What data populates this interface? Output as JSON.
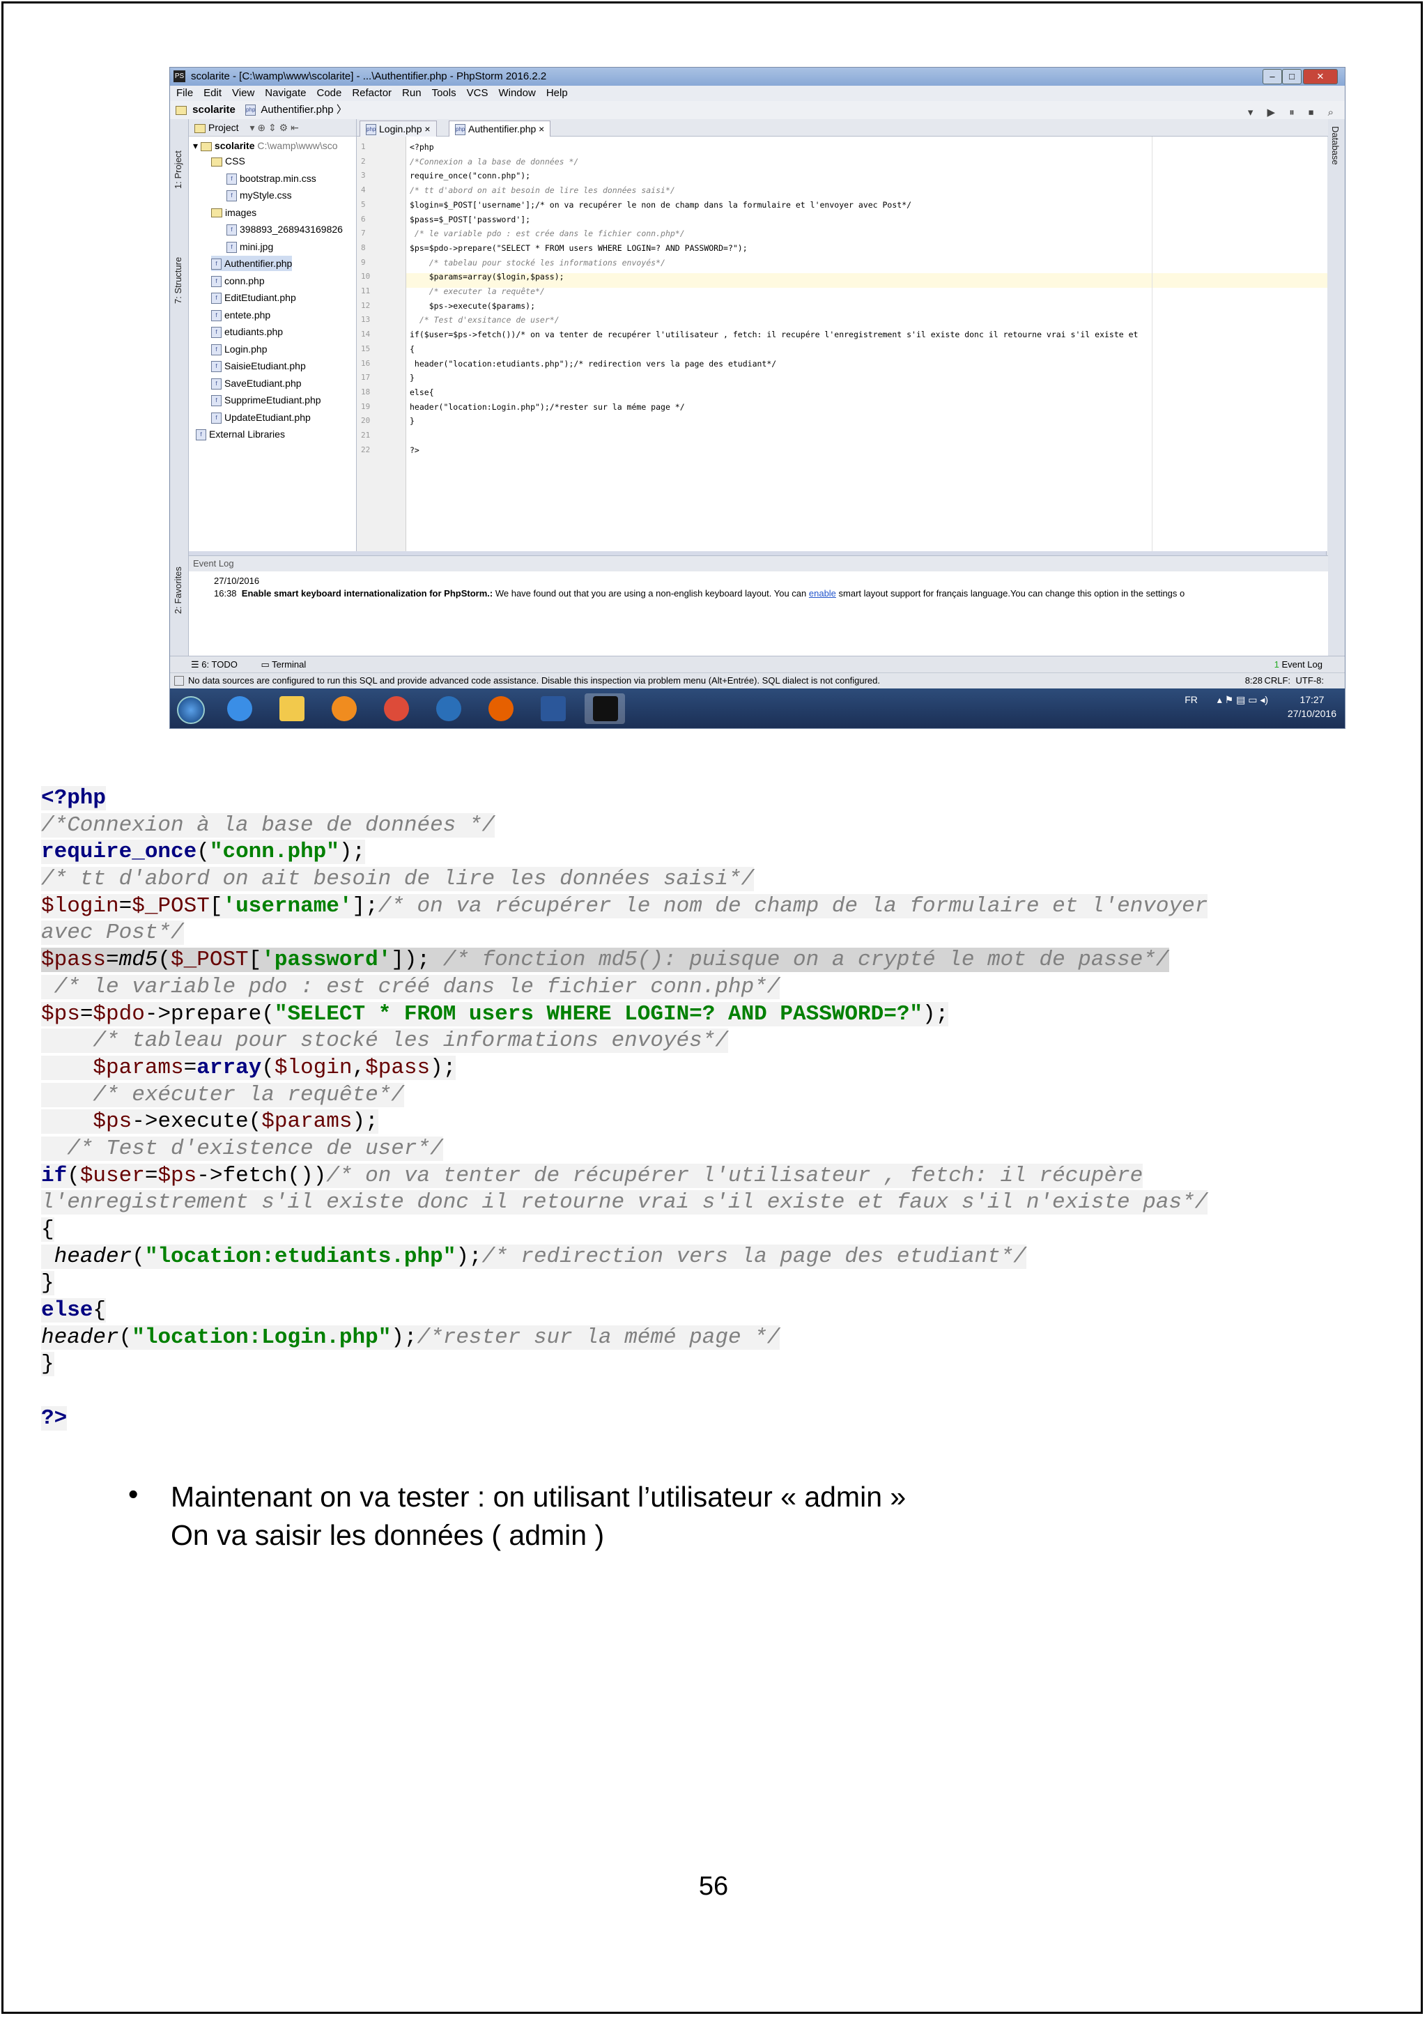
{
  "ide": {
    "window_title": "scolarite - [C:\\wamp\\www\\scolarite] - ...\\Authentifier.php - PhpStorm 2016.2.2",
    "menu": [
      "File",
      "Edit",
      "View",
      "Navigate",
      "Code",
      "Refactor",
      "Run",
      "Tools",
      "VCS",
      "Window",
      "Help"
    ],
    "breadcrumb": [
      "scolarite",
      "Authentifier.php"
    ],
    "left_strip": [
      "1: Project",
      "7: Structure",
      "2: Favorites"
    ],
    "right_strip": [
      "Database"
    ],
    "project_panel": {
      "title": "Project",
      "root": "scolarite",
      "root_path": "C:\\wamp\\www\\sco",
      "items": [
        {
          "label": "CSS",
          "type": "folder"
        },
        {
          "label": "bootstrap.min.css",
          "type": "file"
        },
        {
          "label": "myStyle.css",
          "type": "file"
        },
        {
          "label": "images",
          "type": "folder"
        },
        {
          "label": "398893_268943169826",
          "type": "file"
        },
        {
          "label": "mini.jpg",
          "type": "file"
        },
        {
          "label": "Authentifier.php",
          "type": "file"
        },
        {
          "label": "conn.php",
          "type": "file"
        },
        {
          "label": "EditEtudiant.php",
          "type": "file"
        },
        {
          "label": "entete.php",
          "type": "file"
        },
        {
          "label": "etudiants.php",
          "type": "file"
        },
        {
          "label": "Login.php",
          "type": "file"
        },
        {
          "label": "SaisieEtudiant.php",
          "type": "file"
        },
        {
          "label": "SaveEtudiant.php",
          "type": "file"
        },
        {
          "label": "SupprimeEtudiant.php",
          "type": "file"
        },
        {
          "label": "UpdateEtudiant.php",
          "type": "file"
        },
        {
          "label": "External Libraries",
          "type": "lib"
        }
      ]
    },
    "tabs": [
      "Login.php",
      "Authentifier.php"
    ],
    "editor_lines": [
      "<?php",
      "/*Connexion a la base de données */",
      "require_once(\"conn.php\");",
      "/* tt d'abord on ait besoin de lire les données saisi*/",
      "$login=$_POST['username'];/* on va recupérer le non de champ dans la formulaire et l'envoyer avec Post*/",
      "$pass=$_POST['password'];",
      " /* le variable pdo : est crée dans le fichier conn.php*/",
      "$ps=$pdo->prepare(\"SELECT * FROM users WHERE LOGIN=? AND PASSWORD=?\");",
      "    /* tabelau pour stocké les informations envoyés*/",
      "    $params=array($login,$pass);",
      "    /* executer la requête*/",
      "    $ps->execute($params);",
      "  /* Test d'exsitance de user*/",
      "if($user=$ps->fetch())/* on va tenter de recupérer l'utilisateur , fetch: il recupére l'enregistrement s'il existe donc il retourne vrai s'il existe et",
      "{",
      " header(\"location:etudiants.php\");/* redirection vers la page des etudiant*/",
      "}",
      "else{",
      "header(\"location:Login.php\");/*rester sur la méme page */",
      "}",
      "",
      "?>"
    ],
    "event_log": {
      "title": "Event Log",
      "date": "27/10/2016",
      "time": "16:38",
      "bold": "Enable smart keyboard internationalization for PhpStorm.:",
      "message": " We have found out that you are using a non-english keyboard layout. You can ",
      "link": "enable",
      "message_end": " smart layout support for français language.You can change this option in the settings o"
    },
    "bottom_tools": {
      "todo": "6: TODO",
      "terminal": "Terminal",
      "event_log": "Event Log",
      "event_count": "1"
    },
    "status": {
      "message": "No data sources are configured to run this SQL and provide advanced code assistance. Disable this inspection via problem menu (Alt+Entrée). SQL dialect is not configured.",
      "position": "8:28",
      "line_sep": "CRLF:",
      "encoding": "UTF-8:"
    },
    "taskbar": {
      "lang": "FR",
      "time": "17:27",
      "date": "27/10/2016"
    }
  },
  "code_listing": [
    [
      {
        "t": "<?php",
        "c": "kw"
      }
    ],
    [
      {
        "t": "/*Connexion à la base de données */",
        "c": "cm"
      }
    ],
    [
      {
        "t": "require_once",
        "c": "kw"
      },
      {
        "t": "(",
        "c": ""
      },
      {
        "t": "\"conn.php\"",
        "c": "str"
      },
      {
        "t": ");",
        "c": ""
      }
    ],
    [
      {
        "t": "/* tt d'abord on ait besoin de lire les données saisi*/",
        "c": "cm"
      }
    ],
    [
      {
        "t": "$login",
        "c": "var"
      },
      {
        "t": "=",
        "c": ""
      },
      {
        "t": "$_POST",
        "c": "var"
      },
      {
        "t": "[",
        "c": ""
      },
      {
        "t": "'username'",
        "c": "str"
      },
      {
        "t": "];",
        "c": ""
      },
      {
        "t": "/* on va récupérer le nom de champ de la formulaire et l'envoyer",
        "c": "cm"
      }
    ],
    [
      {
        "t": "avec Post*/",
        "c": "cm"
      }
    ],
    [
      {
        "t": "$pass",
        "c": "var"
      },
      {
        "t": "=",
        "c": ""
      },
      {
        "t": "md5",
        "c": "fn"
      },
      {
        "t": "(",
        "c": ""
      },
      {
        "t": "$_POST",
        "c": "var"
      },
      {
        "t": "[",
        "c": ""
      },
      {
        "t": "'password'",
        "c": "str"
      },
      {
        "t": "]); ",
        "c": ""
      },
      {
        "t": "/* fonction md5(): puisque on a crypté le mot de passe*/",
        "c": "cm"
      }
    ],
    [
      {
        "t": " /* le variable pdo : est créé dans le fichier conn.php*/",
        "c": "cm"
      }
    ],
    [
      {
        "t": "$ps",
        "c": "var"
      },
      {
        "t": "=",
        "c": ""
      },
      {
        "t": "$pdo",
        "c": "var"
      },
      {
        "t": "->prepare(",
        "c": ""
      },
      {
        "t": "\"SELECT * FROM users WHERE LOGIN=? AND PASSWORD=?\"",
        "c": "str"
      },
      {
        "t": ");",
        "c": ""
      }
    ],
    [
      {
        "t": "    /* tableau pour stocké les informations envoyés*/",
        "c": "cm"
      }
    ],
    [
      {
        "t": "    ",
        "c": ""
      },
      {
        "t": "$params",
        "c": "var"
      },
      {
        "t": "=",
        "c": ""
      },
      {
        "t": "array",
        "c": "kw"
      },
      {
        "t": "(",
        "c": ""
      },
      {
        "t": "$login",
        "c": "var"
      },
      {
        "t": ",",
        "c": ""
      },
      {
        "t": "$pass",
        "c": "var"
      },
      {
        "t": ");",
        "c": ""
      }
    ],
    [
      {
        "t": "    /* exécuter la requête*/",
        "c": "cm"
      }
    ],
    [
      {
        "t": "    ",
        "c": ""
      },
      {
        "t": "$ps",
        "c": "var"
      },
      {
        "t": "->execute(",
        "c": ""
      },
      {
        "t": "$params",
        "c": "var"
      },
      {
        "t": ");",
        "c": ""
      }
    ],
    [
      {
        "t": "  /* Test d'existence de user*/",
        "c": "cm"
      }
    ],
    [
      {
        "t": "if",
        "c": "kw"
      },
      {
        "t": "(",
        "c": ""
      },
      {
        "t": "$user",
        "c": "var"
      },
      {
        "t": "=",
        "c": ""
      },
      {
        "t": "$ps",
        "c": "var"
      },
      {
        "t": "->fetch())",
        "c": ""
      },
      {
        "t": "/* on va tenter de récupérer l'utilisateur , fetch: il récupère",
        "c": "cm"
      }
    ],
    [
      {
        "t": "l'enregistrement s'il existe donc il retourne vrai s'il existe et faux s'il n'existe pas*/",
        "c": "cm"
      }
    ],
    [
      {
        "t": "{",
        "c": ""
      }
    ],
    [
      {
        "t": " ",
        "c": ""
      },
      {
        "t": "header",
        "c": "fn"
      },
      {
        "t": "(",
        "c": ""
      },
      {
        "t": "\"location:etudiants.php\"",
        "c": "str"
      },
      {
        "t": ");",
        "c": ""
      },
      {
        "t": "/* redirection vers la page des etudiant*/",
        "c": "cm"
      }
    ],
    [
      {
        "t": "}",
        "c": ""
      }
    ],
    [
      {
        "t": "else",
        "c": "kw"
      },
      {
        "t": "{",
        "c": ""
      }
    ],
    [
      {
        "t": "header",
        "c": "fn"
      },
      {
        "t": "(",
        "c": ""
      },
      {
        "t": "\"location:Login.php\"",
        "c": "str"
      },
      {
        "t": ");",
        "c": ""
      },
      {
        "t": "/*rester sur la mémé page */",
        "c": "cm"
      }
    ],
    [
      {
        "t": "}",
        "c": ""
      }
    ],
    [
      {
        "t": "",
        "c": ""
      }
    ],
    [
      {
        "t": "?>",
        "c": "kw"
      }
    ]
  ],
  "bullet": {
    "line1": "Maintenant on va tester : on utilisant l’utilisateur « admin »",
    "line2": "On va saisir les données ( admin )"
  },
  "page_number": "56"
}
